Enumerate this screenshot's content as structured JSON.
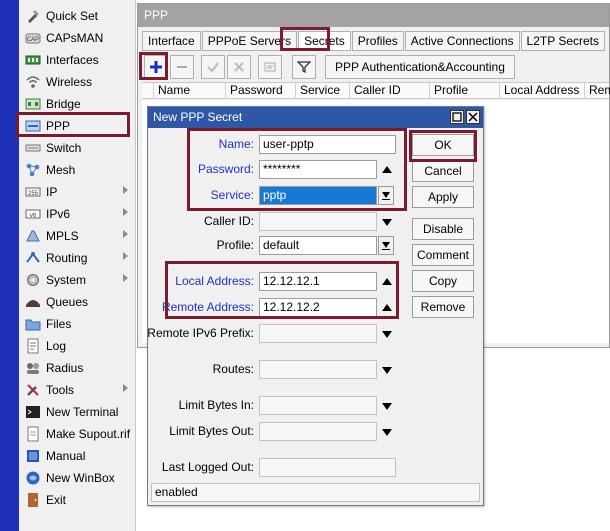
{
  "sidebar": {
    "items": [
      {
        "label": "Quick Set",
        "icon": "quick-set-icon",
        "arrow": false
      },
      {
        "label": "CAPsMAN",
        "icon": "capsman-icon",
        "arrow": false
      },
      {
        "label": "Interfaces",
        "icon": "interfaces-icon",
        "arrow": false
      },
      {
        "label": "Wireless",
        "icon": "wireless-icon",
        "arrow": false
      },
      {
        "label": "Bridge",
        "icon": "bridge-icon",
        "arrow": false
      },
      {
        "label": "PPP",
        "icon": "ppp-icon",
        "arrow": false
      },
      {
        "label": "Switch",
        "icon": "switch-icon",
        "arrow": false
      },
      {
        "label": "Mesh",
        "icon": "mesh-icon",
        "arrow": false
      },
      {
        "label": "IP",
        "icon": "ip-icon",
        "arrow": true
      },
      {
        "label": "IPv6",
        "icon": "ipv6-icon",
        "arrow": true
      },
      {
        "label": "MPLS",
        "icon": "mpls-icon",
        "arrow": true
      },
      {
        "label": "Routing",
        "icon": "routing-icon",
        "arrow": true
      },
      {
        "label": "System",
        "icon": "system-icon",
        "arrow": true
      },
      {
        "label": "Queues",
        "icon": "queues-icon",
        "arrow": false
      },
      {
        "label": "Files",
        "icon": "files-icon",
        "arrow": false
      },
      {
        "label": "Log",
        "icon": "log-icon",
        "arrow": false
      },
      {
        "label": "Radius",
        "icon": "radius-icon",
        "arrow": false
      },
      {
        "label": "Tools",
        "icon": "tools-icon",
        "arrow": true
      },
      {
        "label": "New Terminal",
        "icon": "terminal-icon",
        "arrow": false
      },
      {
        "label": "Make Supout.rif",
        "icon": "supout-icon",
        "arrow": false
      },
      {
        "label": "Manual",
        "icon": "manual-icon",
        "arrow": false
      },
      {
        "label": "New WinBox",
        "icon": "winbox-icon",
        "arrow": false
      },
      {
        "label": "Exit",
        "icon": "exit-icon",
        "arrow": false
      }
    ]
  },
  "ppp_window": {
    "title": "PPP",
    "tabs": [
      "Interface",
      "PPPoE Servers",
      "Secrets",
      "Profiles",
      "Active Connections",
      "L2TP Secrets"
    ],
    "active_tab": "Secrets",
    "toolbar": {
      "auth_button": "PPP Authentication&Accounting"
    },
    "columns": [
      "Name",
      "Password",
      "Service",
      "Caller ID",
      "Profile",
      "Local Address",
      "Remote Address"
    ]
  },
  "dialog": {
    "title": "New PPP Secret",
    "fields": {
      "name": {
        "label": "Name:",
        "value": "user-pptp"
      },
      "password": {
        "label": "Password:",
        "value": "********"
      },
      "service": {
        "label": "Service:",
        "value": "pptp"
      },
      "caller_id": {
        "label": "Caller ID:",
        "value": ""
      },
      "profile": {
        "label": "Profile:",
        "value": "default"
      },
      "local_address": {
        "label": "Local Address:",
        "value": "12.12.12.1"
      },
      "remote_address": {
        "label": "Remote Address:",
        "value": "12.12.12.2"
      },
      "remote_ipv6_prefix": {
        "label": "Remote IPv6 Prefix:",
        "value": ""
      },
      "routes": {
        "label": "Routes:",
        "value": ""
      },
      "limit_bytes_in": {
        "label": "Limit Bytes In:",
        "value": ""
      },
      "limit_bytes_out": {
        "label": "Limit Bytes Out:",
        "value": ""
      },
      "last_logged_out": {
        "label": "Last Logged Out:",
        "value": ""
      }
    },
    "buttons": {
      "ok": "OK",
      "cancel": "Cancel",
      "apply": "Apply",
      "disable": "Disable",
      "comment": "Comment",
      "copy": "Copy",
      "remove": "Remove"
    },
    "status": "enabled"
  },
  "colors": {
    "highlight": "#7b1b2e",
    "field_label_blue": "#1c33c6",
    "title_blue": "#2f57a8",
    "selection_blue": "#1978d3"
  }
}
